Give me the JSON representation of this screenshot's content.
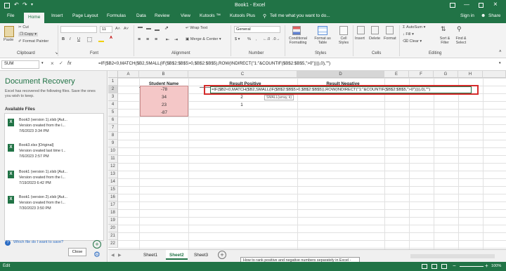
{
  "title_bar": {
    "window_title": "Book1 - Excel",
    "qat_icons": [
      "save-icon",
      "undo-icon",
      "redo-icon"
    ],
    "window_buttons": [
      "ribbon-display-icon",
      "minimize-icon",
      "maximize-icon",
      "close-icon"
    ]
  },
  "tabs": {
    "items": [
      "File",
      "Home",
      "Insert",
      "Page Layout",
      "Formulas",
      "Data",
      "Review",
      "View",
      "Kutools ™",
      "Kutools Plus"
    ],
    "active": "Home",
    "tell_me": "Tell me what you want to do...",
    "sign_in": "Sign in",
    "share": "Share"
  },
  "ribbon": {
    "clipboard": {
      "paste": "Paste",
      "cut": "Cut",
      "copy": "Copy",
      "format_painter": "Format Painter",
      "label": "Clipboard"
    },
    "font": {
      "size": "11",
      "label": "Font",
      "bold": "B",
      "italic": "I",
      "underline": "U"
    },
    "alignment": {
      "wrap": "Wrap Text",
      "merge": "Merge & Center",
      "label": "Alignment"
    },
    "number": {
      "format": "General",
      "label": "Number",
      "percent": "%",
      "comma": ","
    },
    "styles": {
      "conditional": "Conditional Formatting",
      "format_as_table": "Format as Table",
      "cell_styles": "Cell Styles",
      "label": "Styles"
    },
    "cells": {
      "insert": "Insert",
      "delete": "Delete",
      "format": "Format",
      "label": "Cells"
    },
    "editing": {
      "autosum": "AutoSum",
      "fill": "Fill",
      "clear": "Clear",
      "sort": "Sort & Filter",
      "find": "Find & Select",
      "label": "Editing"
    }
  },
  "formula_bar": {
    "name_box": "SUM",
    "fx": "fx",
    "formula": "=IF($B2<0,MATCH($B2,SMALL(IF($B$2:$B$5>0,$B$2:$B$5),ROW(INDIRECT(\"1:\"&COUNTIF($B$2:$B$5,\">0\")))),0),\"\")"
  },
  "document_recovery": {
    "title": "Document Recovery",
    "description": "Excel has recovered the following files. Save the ones you wish to keep.",
    "available_label": "Available Files",
    "files": [
      {
        "name": "Book3 (version 1).xlsb  [Aut...",
        "desc": "Version created from the l...",
        "date": "7/6/2023 3:34 PM"
      },
      {
        "name": "Book3.xlsx  [Original]",
        "desc": "Version created last time t...",
        "date": "7/6/2023 2:57 PM"
      },
      {
        "name": "Book1 (version 1).xlsb  [Aut...",
        "desc": "Version created from the l...",
        "date": "7/19/2023 6:42 PM"
      },
      {
        "name": "Book1 (version 2).xlsb  [Aut...",
        "desc": "Version created from the l...",
        "date": "7/30/2023 3:50 PM"
      }
    ],
    "which_file": "Which file do I want to save?",
    "close": "Close"
  },
  "sheet": {
    "columns": [
      "A",
      "B",
      "C",
      "D",
      "E",
      "F",
      "G",
      "H"
    ],
    "rows": [
      "1",
      "2",
      "3",
      "4",
      "5",
      "6",
      "7",
      "8",
      "9",
      "10",
      "11",
      "12",
      "13",
      "14",
      "15",
      "16",
      "17",
      "18",
      "19",
      "20",
      "21",
      "22"
    ],
    "headers": {
      "b1": "Student Name",
      "c1": "Result Positive",
      "d1": "Result Negative"
    },
    "b_values": [
      "-78",
      "34",
      "23",
      "-87"
    ],
    "c_values": [
      "",
      "2",
      "1",
      ""
    ],
    "editing_formula": "=IF($B2<0,MATCH($B2,SMALL(IF($B$2:$B$5>0,$B$2:$B$5)),ROW(INDIRECT(\"1:\"&COUNTIF($B$2:$B$5,\">0\")))),0),\"\")",
    "tooltip": "SMALL(array, k)"
  },
  "sheet_tabs": {
    "tabs": [
      "Sheet1",
      "Sheet2",
      "Sheet3"
    ],
    "active": "Sheet2",
    "popup": "How to rank positive and negative numbers separately in Excel - Word"
  },
  "status_bar": {
    "mode": "Edit",
    "zoom": "100%"
  },
  "colors": {
    "excel_green": "#217346",
    "selection_fill": "#f4c7c7",
    "highlight_box": "#d42b2b"
  }
}
